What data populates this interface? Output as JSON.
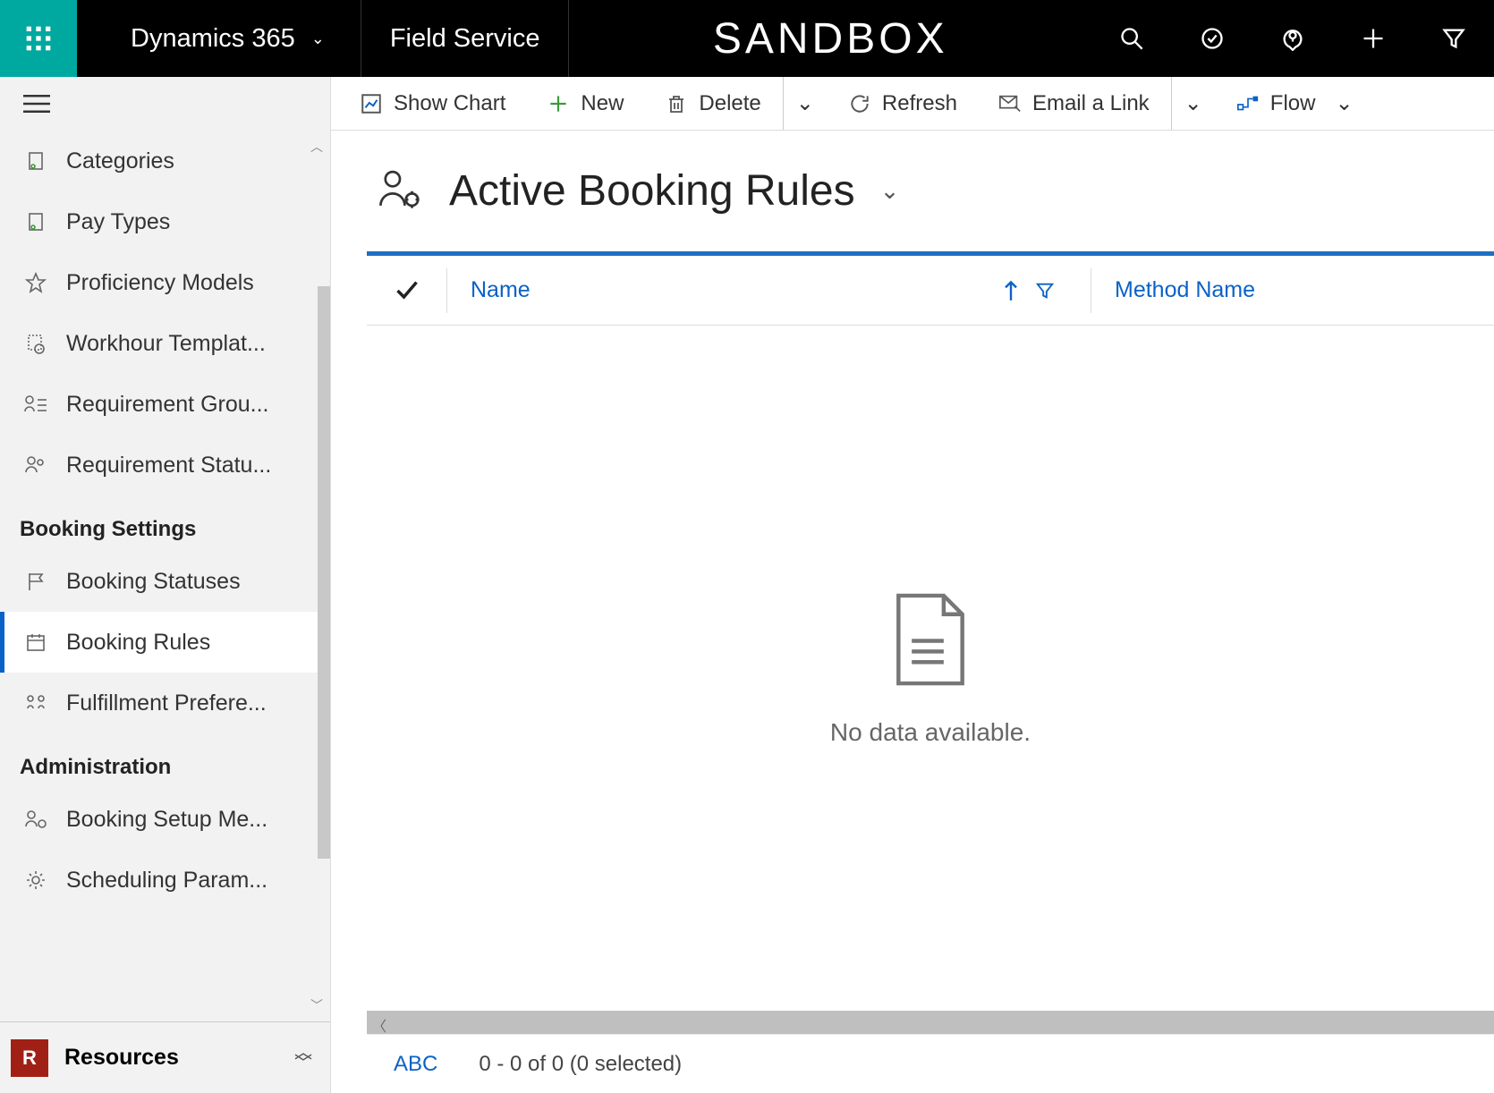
{
  "topbar": {
    "brand": "Dynamics 365",
    "module": "Field Service",
    "environment": "SANDBOX"
  },
  "sidebar": {
    "items_a": [
      {
        "label": "Categories",
        "icon": "doc"
      },
      {
        "label": "Pay Types",
        "icon": "doc"
      },
      {
        "label": "Proficiency Models",
        "icon": "star"
      },
      {
        "label": "Workhour Templat...",
        "icon": "clockdoc"
      },
      {
        "label": "Requirement Grou...",
        "icon": "persongroup"
      },
      {
        "label": "Requirement Statu...",
        "icon": "personstatus"
      }
    ],
    "group_b": "Booking Settings",
    "items_b": [
      {
        "label": "Booking Statuses",
        "icon": "flag"
      },
      {
        "label": "Booking Rules",
        "icon": "calendar",
        "active": true
      },
      {
        "label": "Fulfillment Prefere...",
        "icon": "people"
      }
    ],
    "group_c": "Administration",
    "items_c": [
      {
        "label": "Booking Setup Me...",
        "icon": "persongear"
      },
      {
        "label": "Scheduling Param...",
        "icon": "gear"
      }
    ],
    "area": {
      "badge": "R",
      "name": "Resources"
    }
  },
  "commandbar": {
    "show_chart": "Show Chart",
    "new": "New",
    "delete": "Delete",
    "refresh": "Refresh",
    "email_link": "Email a Link",
    "flow": "Flow"
  },
  "view": {
    "title": "Active Booking Rules"
  },
  "grid": {
    "columns": {
      "name": "Name",
      "method": "Method Name"
    },
    "empty": "No data available.",
    "abc": "ABC",
    "paging": "0 - 0 of 0 (0 selected)"
  }
}
